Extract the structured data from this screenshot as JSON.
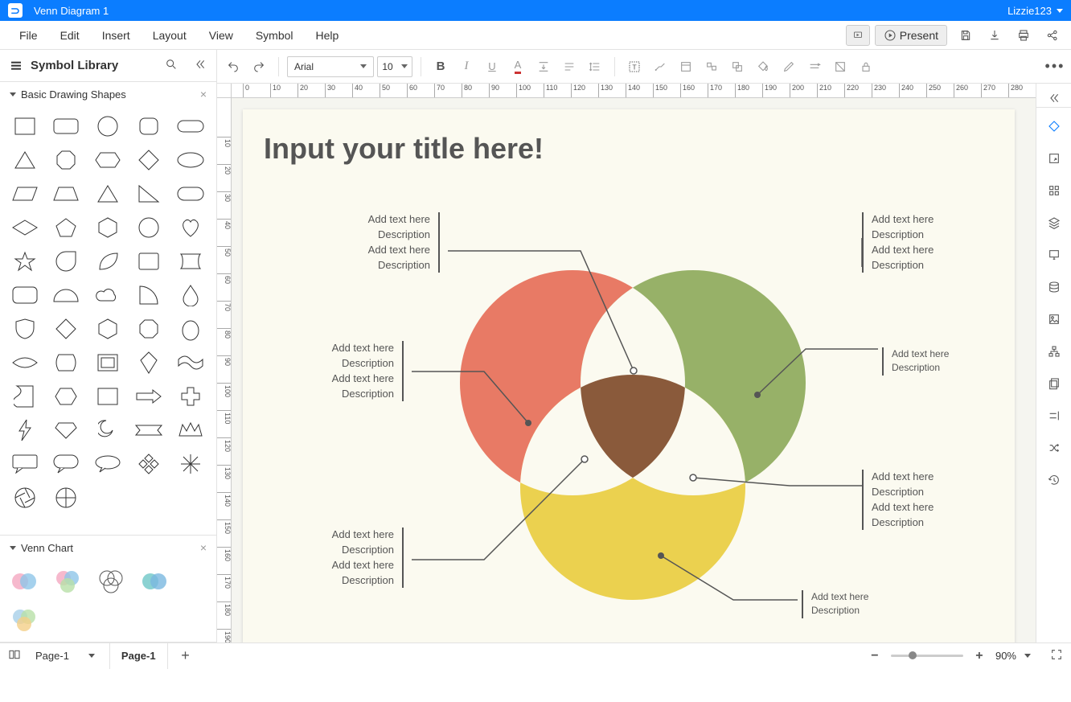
{
  "app": {
    "document_title": "Venn Diagram 1",
    "user": "Lizzie123"
  },
  "menus": [
    "File",
    "Edit",
    "Insert",
    "Layout",
    "View",
    "Symbol",
    "Help"
  ],
  "menu_right": {
    "present_label": "Present"
  },
  "toolbar": {
    "font": "Arial",
    "font_size": "10"
  },
  "sidebar": {
    "title": "Symbol Library",
    "sections": {
      "basic": "Basic Drawing Shapes",
      "venn": "Venn Chart"
    }
  },
  "canvas": {
    "title": "Input your title here!",
    "callouts": {
      "top_left": [
        "Add text here",
        "Description",
        "Add text here",
        "Description"
      ],
      "top_right": [
        "Add text here",
        "Description",
        "Add text here",
        "Description"
      ],
      "mid_left": [
        "Add text here",
        "Description",
        "Add text here",
        "Description"
      ],
      "mid_right_small": [
        "Add text here",
        "Description"
      ],
      "bot_left": [
        "Add text here",
        "Description",
        "Add text here",
        "Description"
      ],
      "bot_right": [
        "Add text here",
        "Description",
        "Add text here",
        "Description"
      ],
      "bot_right_small": [
        "Add text here",
        "Description"
      ]
    },
    "colors": {
      "circle1": "#e66b55",
      "circle2": "#8ca959",
      "circle3": "#e9cc3d",
      "overlap_all": "#8a5a3b"
    }
  },
  "bottom": {
    "page_select": "Page-1",
    "page_tab": "Page-1",
    "zoom": "90%"
  }
}
